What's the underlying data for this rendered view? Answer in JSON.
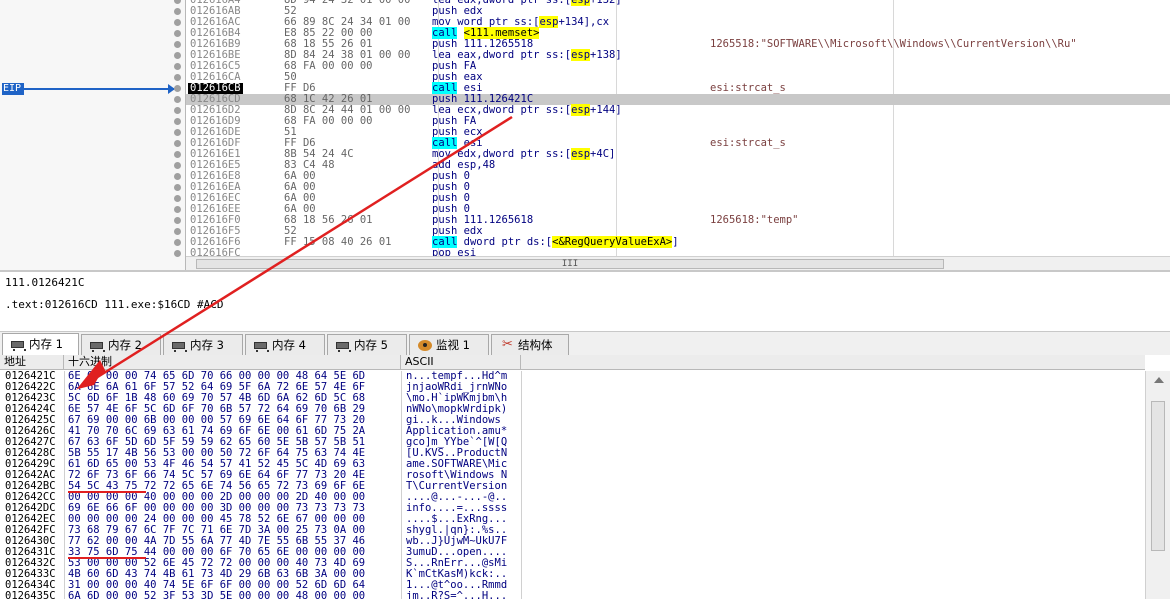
{
  "disasm": {
    "eip_label": "EIP",
    "rows": [
      {
        "addr": "012616A4",
        "bytes": "8D 94 24 32 01 00 00",
        "asm": [
          {
            "t": "lea edx,dword ptr ss:["
          },
          {
            "t": "esp",
            "c": "seg"
          },
          {
            "t": "+132]"
          }
        ],
        "cmt": ""
      },
      {
        "addr": "012616AB",
        "bytes": "52",
        "asm": [
          {
            "t": "push edx"
          }
        ],
        "cmt": ""
      },
      {
        "addr": "012616AC",
        "bytes": "66 89 8C 24 34 01 00",
        "asm": [
          {
            "t": "mov word ptr ss:["
          },
          {
            "t": "esp",
            "c": "seg"
          },
          {
            "t": "+134],cx"
          }
        ],
        "cmt": ""
      },
      {
        "addr": "012616B4",
        "bytes": "E8 85 22 00 00",
        "asm": [
          {
            "t": "call",
            "c": "call"
          },
          {
            "t": " "
          },
          {
            "t": "<111.memset>",
            "c": "calllbl"
          }
        ],
        "cmt": ""
      },
      {
        "addr": "012616B9",
        "bytes": "68 18 55 26 01",
        "asm": [
          {
            "t": "push 111.1265518"
          }
        ],
        "cmt": "1265518:\"SOFTWARE\\\\Microsoft\\\\Windows\\\\CurrentVersion\\\\Ru\""
      },
      {
        "addr": "012616BE",
        "bytes": "8D 84 24 38 01 00 00",
        "asm": [
          {
            "t": "lea eax,dword ptr ss:["
          },
          {
            "t": "esp",
            "c": "seg"
          },
          {
            "t": "+138]"
          }
        ],
        "cmt": ""
      },
      {
        "addr": "012616C5",
        "bytes": "68 FA 00 00 00",
        "asm": [
          {
            "t": "push FA"
          }
        ],
        "cmt": ""
      },
      {
        "addr": "012616CA",
        "bytes": "50",
        "asm": [
          {
            "t": "push eax"
          }
        ],
        "cmt": ""
      },
      {
        "addr": "012616CB",
        "bytes": "FF D6",
        "asm": [
          {
            "t": "call",
            "c": "call"
          },
          {
            "t": " esi"
          }
        ],
        "cmt": "esi:strcat_s",
        "current": true
      },
      {
        "addr": "012616CD",
        "bytes": "68 1C 42 26 01",
        "asm": [
          {
            "t": "push 111.126421C"
          }
        ],
        "cmt": "",
        "highlight": true
      },
      {
        "addr": "012616D2",
        "bytes": "8D 8C 24 44 01 00 00",
        "asm": [
          {
            "t": "lea ecx,dword ptr ss:["
          },
          {
            "t": "esp",
            "c": "seg"
          },
          {
            "t": "+144]"
          }
        ],
        "cmt": ""
      },
      {
        "addr": "012616D9",
        "bytes": "68 FA 00 00 00",
        "asm": [
          {
            "t": "push FA"
          }
        ],
        "cmt": ""
      },
      {
        "addr": "012616DE",
        "bytes": "51",
        "asm": [
          {
            "t": "push ecx"
          }
        ],
        "cmt": ""
      },
      {
        "addr": "012616DF",
        "bytes": "FF D6",
        "asm": [
          {
            "t": "call",
            "c": "call"
          },
          {
            "t": " esi"
          }
        ],
        "cmt": "esi:strcat_s"
      },
      {
        "addr": "012616E1",
        "bytes": "8B 54 24 4C",
        "asm": [
          {
            "t": "mov edx,dword ptr ss:["
          },
          {
            "t": "esp",
            "c": "seg"
          },
          {
            "t": "+4C]"
          }
        ],
        "cmt": ""
      },
      {
        "addr": "012616E5",
        "bytes": "83 C4 48",
        "asm": [
          {
            "t": "add esp,48"
          }
        ],
        "cmt": ""
      },
      {
        "addr": "012616E8",
        "bytes": "6A 00",
        "asm": [
          {
            "t": "push 0"
          }
        ],
        "cmt": ""
      },
      {
        "addr": "012616EA",
        "bytes": "6A 00",
        "asm": [
          {
            "t": "push 0"
          }
        ],
        "cmt": ""
      },
      {
        "addr": "012616EC",
        "bytes": "6A 00",
        "asm": [
          {
            "t": "push 0"
          }
        ],
        "cmt": ""
      },
      {
        "addr": "012616EE",
        "bytes": "6A 00",
        "asm": [
          {
            "t": "push 0"
          }
        ],
        "cmt": ""
      },
      {
        "addr": "012616F0",
        "bytes": "68 18 56 26 01",
        "asm": [
          {
            "t": "push 111.1265618"
          }
        ],
        "cmt": "1265618:\"temp\""
      },
      {
        "addr": "012616F5",
        "bytes": "52",
        "asm": [
          {
            "t": "push edx"
          }
        ],
        "cmt": ""
      },
      {
        "addr": "012616F6",
        "bytes": "FF 15 08 40 26 01",
        "asm": [
          {
            "t": "call",
            "c": "call"
          },
          {
            "t": " dword ptr ds:["
          },
          {
            "t": "<&RegQueryValueExA>",
            "c": "calllbl"
          },
          {
            "t": "]"
          }
        ],
        "cmt": ""
      },
      {
        "addr": "012616FC",
        "bytes": "",
        "asm": [
          {
            "t": "pop esi"
          }
        ],
        "cmt": ""
      }
    ],
    "scroll_label": "III"
  },
  "info": {
    "line1": "111.0126421C",
    "line2": ".text:012616CD 111.exe:$16CD #ACD"
  },
  "tabs": [
    {
      "label": "内存 1",
      "icon": "memory-chip-icon",
      "active": true
    },
    {
      "label": "内存 2",
      "icon": "memory-chip-icon"
    },
    {
      "label": "内存 3",
      "icon": "memory-chip-icon"
    },
    {
      "label": "内存 4",
      "icon": "memory-chip-icon"
    },
    {
      "label": "内存 5",
      "icon": "memory-chip-icon"
    },
    {
      "label": "监视 1",
      "icon": "watch-eye-icon"
    },
    {
      "label": "结构体",
      "icon": "struct-icon"
    }
  ],
  "dump": {
    "headers": {
      "addr": "地址",
      "hex": "十六进制",
      "ascii": "ASCII"
    },
    "rows": [
      {
        "addr": "0126421C",
        "hex": "6E 00 00 00 74 65 6D 70 66 00 00 00 48 64 5E 6D",
        "ascii": "n...tempf...Hd^m"
      },
      {
        "addr": "0126422C",
        "hex": "6A 6E 6A 61 6F 57 52 64 69 5F 6A 72 6E 57 4E 6F",
        "ascii": "jnjaoWRdi_jrnWNo"
      },
      {
        "addr": "0126423C",
        "hex": "5C 6D 6F 1B 48 60 69 70 57 4B 6D 6A 62 6D 5C 68",
        "ascii": "\\mo.H`ipWKmjbm\\h"
      },
      {
        "addr": "0126424C",
        "hex": "6E 57 4E 6F 5C 6D 6F 70 6B 57 72 64 69 70 6B 29",
        "ascii": "nWNo\\mopkWrdipk)"
      },
      {
        "addr": "0126425C",
        "hex": "67 69 00 00 6B 00 00 00 57 69 6E 64 6F 77 73 20",
        "ascii": "gi..k...Windows "
      },
      {
        "addr": "0126426C",
        "hex": "41 70 70 6C 69 63 61 74 69 6F 6E 00 61 6D 75 2A",
        "ascii": "Application.amu*"
      },
      {
        "addr": "0126427C",
        "hex": "67 63 6F 5D 6D 5F 59 59 62 65 60 5E 5B 57 5B 51",
        "ascii": "gco]m_YYbe`^[W[Q"
      },
      {
        "addr": "0126428C",
        "hex": "5B 55 17 4B 56 53 00 00 50 72 6F 64 75 63 74 4E",
        "ascii": "[U.KVS..ProductN"
      },
      {
        "addr": "0126429C",
        "hex": "61 6D 65 00 53 4F 46 54 57 41 52 45 5C 4D 69 63",
        "ascii": "ame.SOFTWARE\\Mic"
      },
      {
        "addr": "012642AC",
        "hex": "72 6F 73 6F 66 74 5C 57 69 6E 64 6F 77 73 20 4E",
        "ascii": "rosoft\\Windows N"
      },
      {
        "addr": "012642BC",
        "hex": "54 5C 43 75 72 72 65 6E 74 56 65 72 73 69 6F 6E",
        "ascii": "T\\CurrentVersion"
      },
      {
        "addr": "012642CC",
        "hex": "00 00 00 00 40 00 00 00 2D 00 00 00 2D 40 00 00",
        "ascii": "....@...-...-@.."
      },
      {
        "addr": "012642DC",
        "hex": "69 6E 66 6F 00 00 00 00 3D 00 00 00 73 73 73 73",
        "ascii": "info....=...ssss"
      },
      {
        "addr": "012642EC",
        "hex": "00 00 00 00 24 00 00 00 45 78 52 6E 67 00 00 00",
        "ascii": "....$...ExRng..."
      },
      {
        "addr": "012642FC",
        "hex": "73 68 79 67 6C 7F 7C 71 6E 7D 3A 00 25 73 0A 00",
        "ascii": "shygl.|qn}:.%s.."
      },
      {
        "addr": "0126430C",
        "hex": "77 62 00 00 4A 7D 55 6A 77 4D 7E 55 6B 55 37 46",
        "ascii": "wb..J}UjwM~UkU7F"
      },
      {
        "addr": "0126431C",
        "hex": "33 75 6D 75 44 00 00 00 6F 70 65 6E 00 00 00 00",
        "ascii": "3umuD...open...."
      },
      {
        "addr": "0126432C",
        "hex": "53 00 00 00 52 6E 45 72 72 00 00 00 40 73 4D 69",
        "ascii": "S...RnErr...@sMi"
      },
      {
        "addr": "0126433C",
        "hex": "4B 60 6D 43 74 4B 61 73 4D 29 6B 63 6B 3A 00 00",
        "ascii": "K`mCtKasM)kck:.."
      },
      {
        "addr": "0126434C",
        "hex": "31 00 00 00 40 74 5E 6F 6F 00 00 00 52 6D 6D 64",
        "ascii": "1...@t^oo...Rmmd"
      },
      {
        "addr": "0126435C",
        "hex": "6A 6D 00 00 52 3F 53 3D 5E 00 00 00 48 00 00 00",
        "ascii": "jm..R?S=^...H..."
      }
    ]
  },
  "colors": {
    "eip": "#1f63c6",
    "annotation": "#e02020",
    "call_bg": "#00ffff",
    "label_bg": "#ffff00"
  }
}
